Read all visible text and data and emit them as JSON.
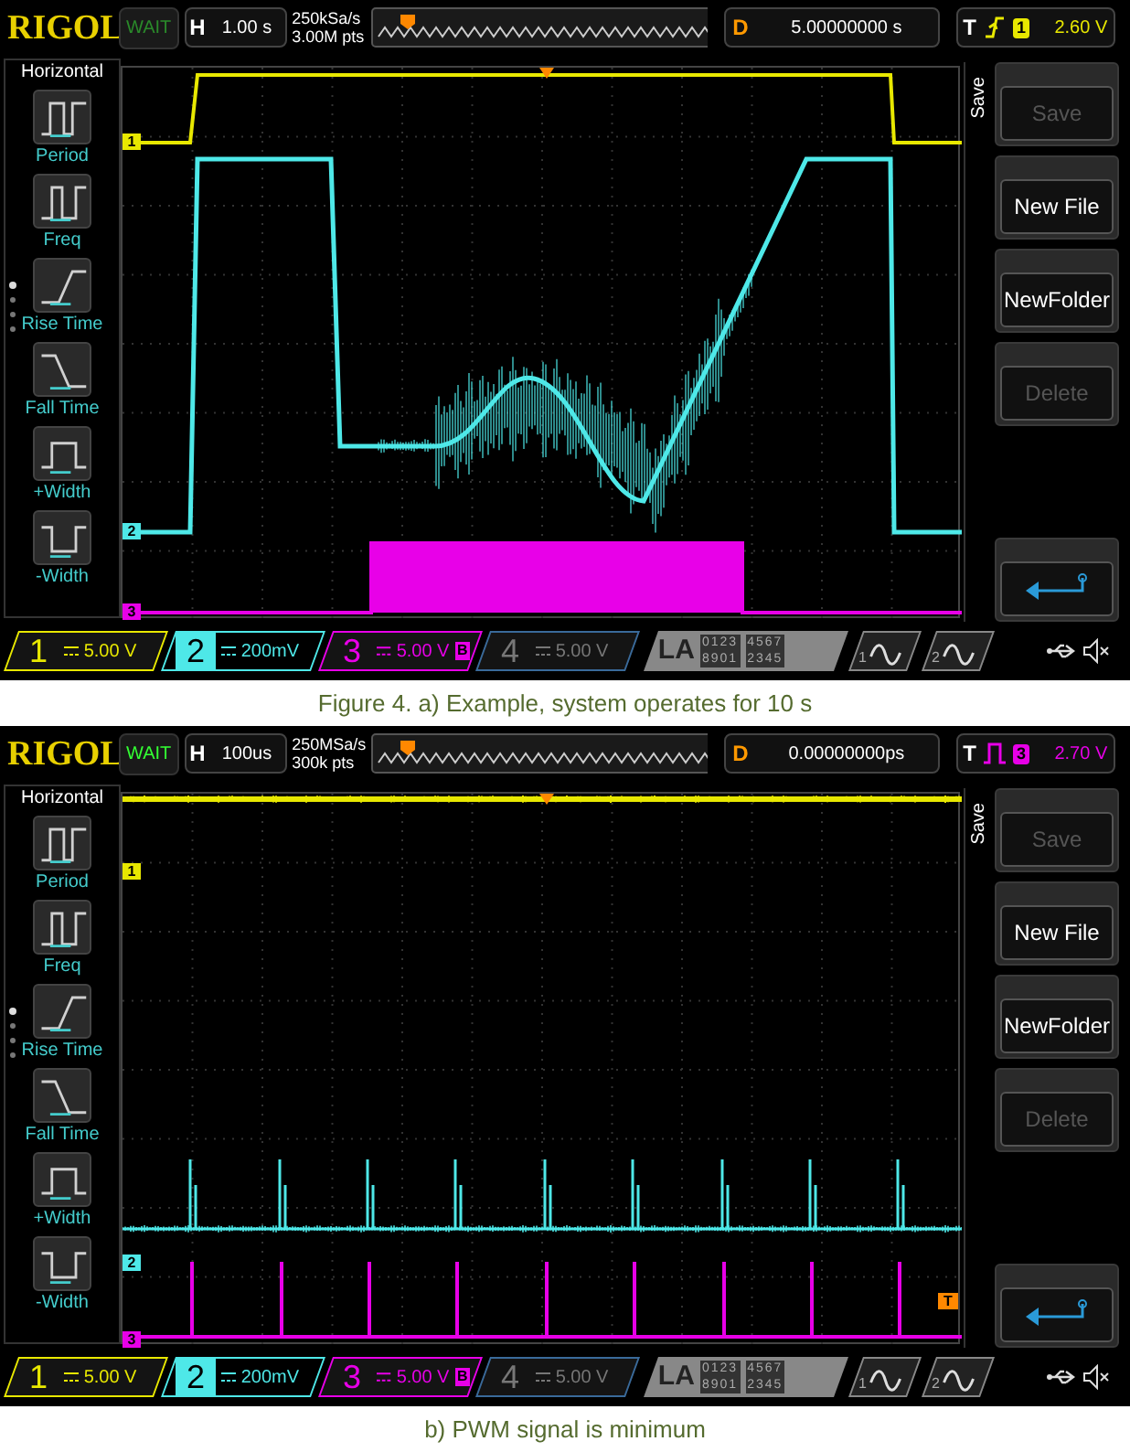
{
  "figures": [
    {
      "kind": "system_run",
      "scope": {
        "logo": "RIGOL",
        "run_state": {
          "label": "WAIT",
          "highlighted": false
        },
        "timebase": {
          "label": "H",
          "value": "1.00 s"
        },
        "sample_rate": "250kSa/s",
        "memory_depth": "3.00M pts",
        "delay": {
          "label": "D",
          "value": "5.00000000 s"
        },
        "trigger": {
          "label": "T",
          "kind": "edge",
          "color": "#e8e800",
          "source_label": "1",
          "level": "2.60 V"
        },
        "markers": [
          {
            "label": "1"
          },
          {
            "label": "2"
          },
          {
            "label": "3"
          }
        ],
        "left_menu": {
          "title": "Horizontal",
          "items": [
            {
              "kind": "period",
              "label": "Period"
            },
            {
              "kind": "freq",
              "label": "Freq"
            },
            {
              "kind": "rise",
              "label": "Rise Time"
            },
            {
              "kind": "fall",
              "label": "Fall Time"
            },
            {
              "kind": "pwidth",
              "label": "+Width"
            },
            {
              "kind": "nwidth",
              "label": "-Width"
            }
          ]
        },
        "right_menu": {
          "title": "Save",
          "buttons": [
            {
              "kind": "text",
              "label": "Save",
              "disabled": true
            },
            {
              "kind": "text",
              "label": "New File",
              "disabled": false
            },
            {
              "kind": "text",
              "label": "NewFolder",
              "disabled": false
            },
            {
              "kind": "text",
              "label": "Delete",
              "disabled": true
            },
            {
              "kind": "return"
            }
          ]
        },
        "channels": [
          {
            "number": "1",
            "scale": "5.00 V",
            "color": "#e8e800",
            "enabled": true,
            "selected": false,
            "bw_limit": false
          },
          {
            "number": "2",
            "scale": "200mV",
            "color": "#4ee8e8",
            "enabled": true,
            "selected": true,
            "bw_limit": false
          },
          {
            "number": "3",
            "scale": "5.00 V",
            "color": "#e800e8",
            "enabled": true,
            "selected": false,
            "bw_limit": true,
            "bw_label": "B"
          },
          {
            "number": "4",
            "scale": "5.00 V",
            "color": "#3a6a9a",
            "enabled": false,
            "selected": false,
            "bw_limit": false
          }
        ],
        "la": {
          "label": "LA",
          "bits": [
            "0123",
            "4567",
            "8901",
            "2345"
          ]
        },
        "math": [
          {
            "number": "1"
          },
          {
            "number": "2"
          }
        ]
      },
      "caption": "Figure 4. a) Example, system operates for 10 s"
    },
    {
      "kind": "pwm_minimum",
      "scope": {
        "logo": "RIGOL",
        "run_state": {
          "label": "WAIT",
          "highlighted": true
        },
        "timebase": {
          "label": "H",
          "value": "100us"
        },
        "sample_rate": "250MSa/s",
        "memory_depth": "300k pts",
        "delay": {
          "label": "D",
          "value": "0.00000000ps"
        },
        "trigger": {
          "label": "T",
          "kind": "pulse",
          "color": "#e800e8",
          "source_label": "3",
          "level": "2.70 V"
        },
        "markers": [
          {
            "label": "1"
          },
          {
            "label": "2"
          },
          {
            "label": "3"
          }
        ],
        "trigger_level_marker": "T",
        "left_menu": {
          "title": "Horizontal",
          "items": [
            {
              "kind": "period",
              "label": "Period"
            },
            {
              "kind": "freq",
              "label": "Freq"
            },
            {
              "kind": "rise",
              "label": "Rise Time"
            },
            {
              "kind": "fall",
              "label": "Fall Time"
            },
            {
              "kind": "pwidth",
              "label": "+Width"
            },
            {
              "kind": "nwidth",
              "label": "-Width"
            }
          ]
        },
        "right_menu": {
          "title": "Save",
          "buttons": [
            {
              "kind": "text",
              "label": "Save",
              "disabled": true
            },
            {
              "kind": "text",
              "label": "New File",
              "disabled": false
            },
            {
              "kind": "text",
              "label": "NewFolder",
              "disabled": false
            },
            {
              "kind": "text",
              "label": "Delete",
              "disabled": true
            },
            {
              "kind": "return"
            }
          ]
        },
        "channels": [
          {
            "number": "1",
            "scale": "5.00 V",
            "color": "#e8e800",
            "enabled": true,
            "selected": false,
            "bw_limit": false
          },
          {
            "number": "2",
            "scale": "200mV",
            "color": "#4ee8e8",
            "enabled": true,
            "selected": true,
            "bw_limit": false
          },
          {
            "number": "3",
            "scale": "5.00 V",
            "color": "#e800e8",
            "enabled": true,
            "selected": false,
            "bw_limit": true,
            "bw_label": "B"
          },
          {
            "number": "4",
            "scale": "5.00 V",
            "color": "#3a6a9a",
            "enabled": false,
            "selected": false,
            "bw_limit": false
          }
        ],
        "la": {
          "label": "LA",
          "bits": [
            "0123",
            "4567",
            "8901",
            "2345"
          ]
        },
        "math": [
          {
            "number": "1"
          },
          {
            "number": "2"
          }
        ]
      },
      "caption": "b) PWM signal is minimum"
    }
  ]
}
